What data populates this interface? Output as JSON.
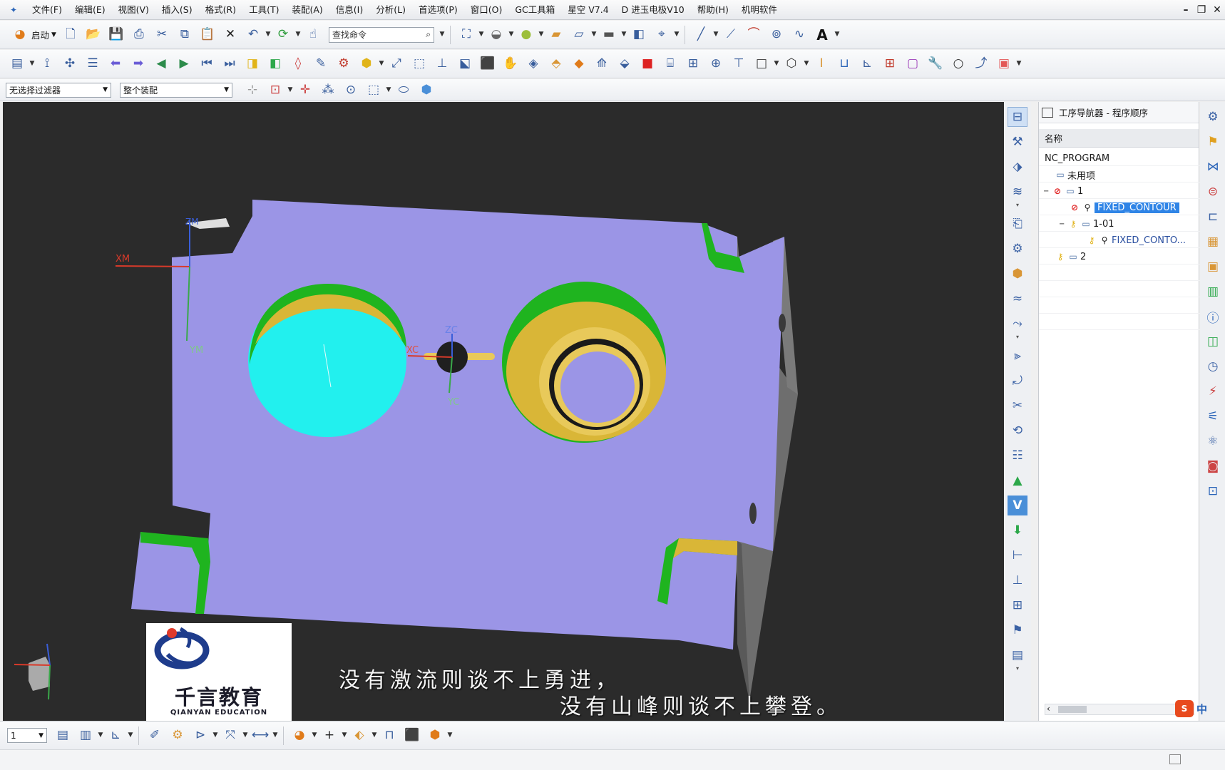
{
  "menu": {
    "items": [
      "文件(F)",
      "编辑(E)",
      "视图(V)",
      "插入(S)",
      "格式(R)",
      "工具(T)",
      "装配(A)",
      "信息(I)",
      "分析(L)",
      "首选项(P)",
      "窗口(O)",
      "GC工具箱",
      "星空 V7.4",
      "D 进玉电极V10",
      "帮助(H)",
      "机明软件"
    ]
  },
  "toolbar": {
    "start_label": "启动",
    "search_placeholder": "查找命令",
    "selection_filter": "无选择过滤器",
    "assembly_scope": "整个装配",
    "text_tool_glyph": "A"
  },
  "viewport": {
    "wcs_labels": {
      "zm": "ZM",
      "xm": "XM",
      "ym": "YM",
      "zc": "ZC",
      "xc": "XC",
      "yc": "YC"
    },
    "subtitle_line1": "没有激流则谈不上勇进，",
    "subtitle_line2": "没有山峰则谈不上攀登。",
    "logo_cn": "千言教育",
    "logo_en": "QIANYAN EDUCATION"
  },
  "navigator": {
    "title": "工序导航器 - 程序顺序",
    "column_name": "名称",
    "tree": [
      {
        "label": "NC_PROGRAM",
        "level": 0,
        "icon": "none"
      },
      {
        "label": "未用项",
        "level": 1,
        "icon": "folder-icon"
      },
      {
        "label": "1",
        "level": 1,
        "icon": "folder-icon",
        "status": "not-generated-icon"
      },
      {
        "label": "FIXED_CONTOUR",
        "level": 2,
        "icon": "operation-icon",
        "status": "not-generated-icon",
        "selected": true
      },
      {
        "label": "1-01",
        "level": 2,
        "icon": "folder-icon",
        "status": "key-icon"
      },
      {
        "label": "FIXED_CONTO...",
        "level": 3,
        "icon": "operation-icon",
        "status": "key-icon"
      },
      {
        "label": "2",
        "level": 1,
        "icon": "folder-icon",
        "status": "key-icon"
      }
    ]
  },
  "bottom": {
    "layer_value": "1"
  },
  "status": {
    "ime_label": "中"
  },
  "colors": {
    "part_face": "#9b95e6",
    "pocket_cyan": "#22f0ee",
    "pocket_gold": "#d9b637",
    "wall_green": "#1fb41f",
    "viewport_bg": "#2b2b2b",
    "selection": "#2f84e6"
  }
}
